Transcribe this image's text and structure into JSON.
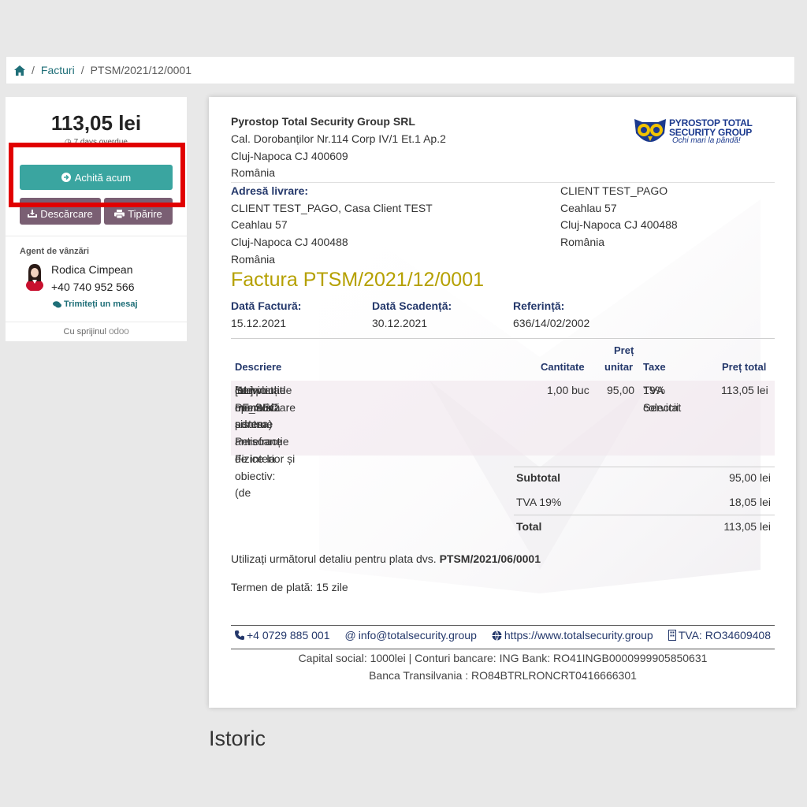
{
  "breadcrumb": {
    "invoices": "Facturi",
    "current": "PTSM/2021/12/0001",
    "sep": "/"
  },
  "sidebar": {
    "amount": "113,05 lei",
    "overdue": "7 days overdue",
    "pay_label": "Achită acum",
    "download_label": "Descărcare",
    "print_label": "Tipărire",
    "agent_title": "Agent de vânzări",
    "agent_name": "Rodica Cimpean",
    "agent_phone": "+40 740 952 566",
    "message_label": "Trimiteți un mesaj",
    "powered_by": "Cu sprijinul",
    "powered_brand": "odoo"
  },
  "company": {
    "name": "Pyrostop Total Security Group SRL",
    "address1": "Cal. Dorobanților Nr.114 Corp IV/1 Et.1 Ap.2",
    "address2": "Cluj-Napoca CJ 400609",
    "country": "România",
    "logo_line1": "PYROSTOP TOTAL",
    "logo_line2": "SECURITY GROUP",
    "logo_slogan": "Ochi mari la pândă!"
  },
  "delivery": {
    "label": "Adresă livrare:",
    "line1": "CLIENT TEST_PAGO, Casa Client TEST",
    "line2": "Ceahlau 57",
    "line3": "Cluj-Napoca CJ 400488",
    "line4": "România"
  },
  "client": {
    "line1": "CLIENT TEST_PAGO",
    "line2": "Ceahlau 57",
    "line3": "Cluj-Napoca CJ 400488",
    "line4": "România"
  },
  "invoice": {
    "title": "Factura PTSM/2021/12/0001",
    "date_label": "Dată Factură:",
    "date": "15.12.2021",
    "due_label": "Dată Scadență:",
    "due": "30.12.2021",
    "ref_label": "Referință:",
    "ref": "636/14/02/2002"
  },
  "table": {
    "headers": {
      "desc": "Descriere",
      "qty": "Cantitate",
      "price_top": "Preț",
      "price_bottom": "unitar",
      "taxes": "Taxe",
      "total": "Preț total"
    },
    "rows": [
      {
        "desc1": "[1L] PF_SEC",
        "desc2": "Serviciul de monitorizare sisteme antiefracție de interior și",
        "desc3": "intervenție operativă pentru Persoane Fizice la obiectiv: (de",
        "desc4": "completat nume si adresa)",
        "qty": "1,00 buc",
        "price": "95,00",
        "tax1": "TVA colectat",
        "tax2": "19% Servicii",
        "total": "113,05 lei"
      }
    ]
  },
  "totals": {
    "subtotal_label": "Subtotal",
    "subtotal": "95,00 lei",
    "tva_label": "TVA 19%",
    "tva": "18,05 lei",
    "total_label": "Total",
    "total": "113,05 lei"
  },
  "payment": {
    "ref_prefix": "Utilizați următorul detaliu pentru plata dvs.",
    "ref_code": "PTSM/2021/06/0001",
    "terms": "Termen de plată: 15 zile"
  },
  "footer": {
    "phone": "+4 0729 885 001",
    "email": "info@totalsecurity.group",
    "website": "https://www.totalsecurity.group",
    "tva": "TVA: RO34609408",
    "bank1": "Capital social: 1000lei | Conturi bancare: ING Bank: RO41INGB0000999905850631",
    "bank2": "Banca Transilvania : RO84BTRLRONCRT0416666301"
  },
  "history_title": "Istoric",
  "colors": {
    "teal": "#3aa5a0",
    "mauve": "#7a5f73",
    "highlight": "#e10000",
    "title_gold": "#b5a000",
    "navy": "#24386b"
  }
}
